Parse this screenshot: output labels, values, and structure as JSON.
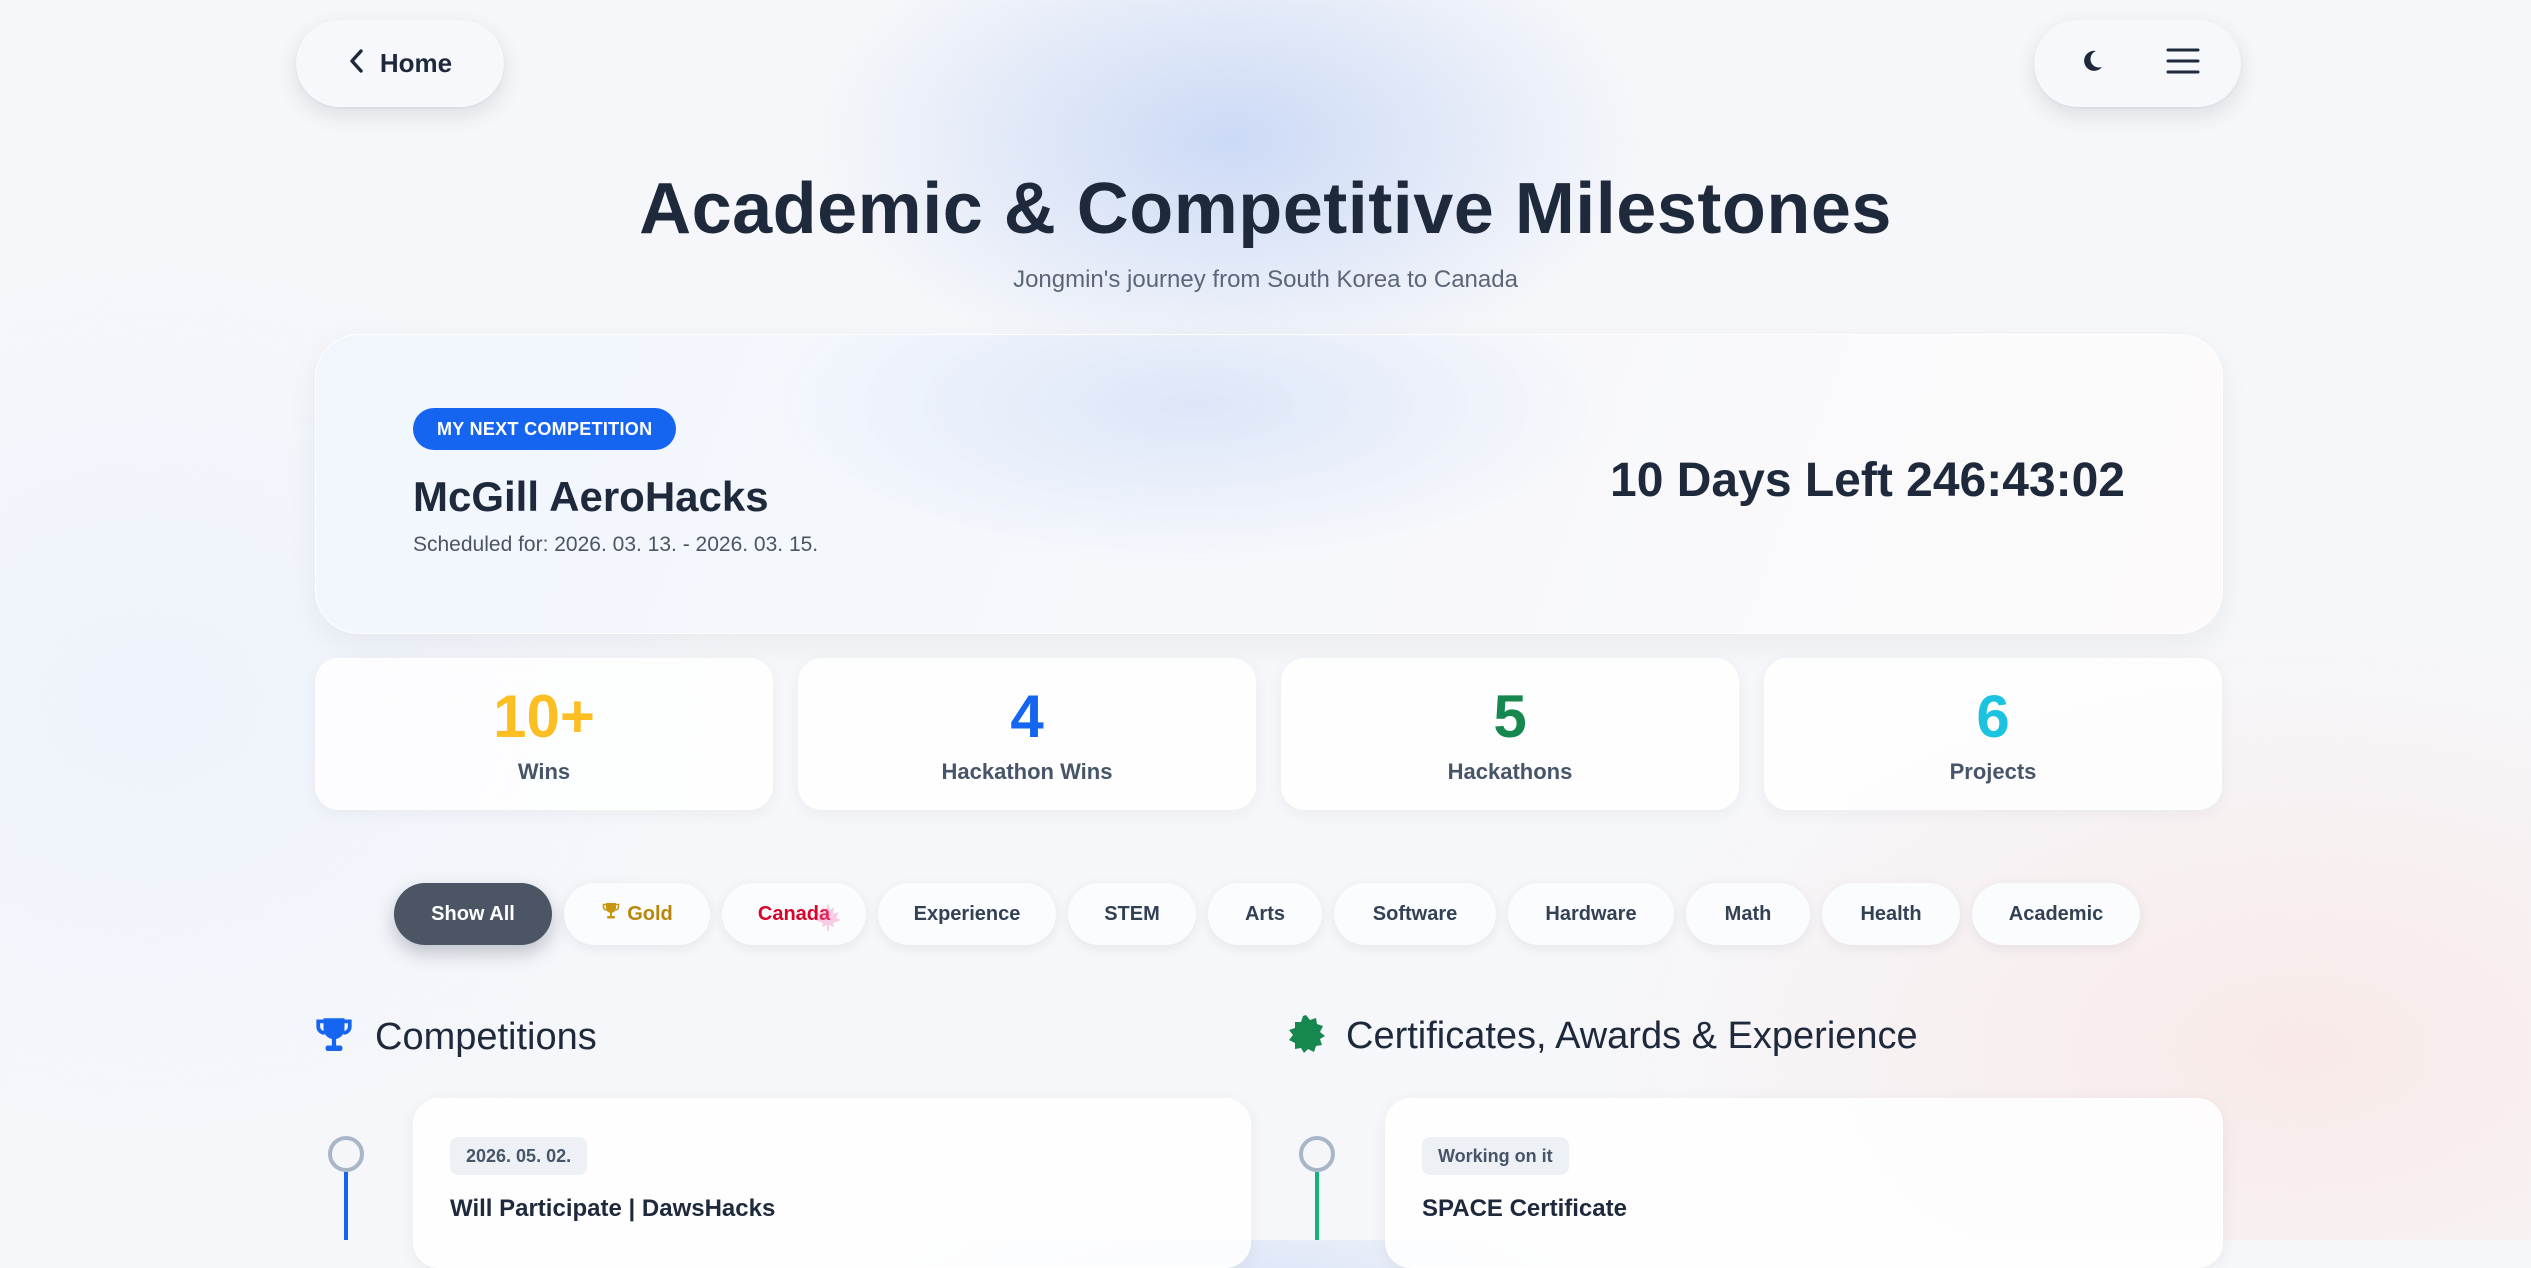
{
  "nav": {
    "home_label": "Home"
  },
  "header": {
    "title": "Academic & Competitive Milestones",
    "subtitle": "Jongmin's journey from South Korea to Canada"
  },
  "next_competition": {
    "badge": "MY NEXT COMPETITION",
    "name": "McGill AeroHacks",
    "schedule": "Scheduled for: 2026. 03. 13. - 2026. 03. 15.",
    "countdown": "10 Days Left 246:43:02"
  },
  "stats": [
    {
      "value": "10+",
      "label": "Wins",
      "color": "#fbbf24"
    },
    {
      "value": "4",
      "label": "Hackathon Wins",
      "color": "#1565f0"
    },
    {
      "value": "5",
      "label": "Hackathons",
      "color": "#16884f"
    },
    {
      "value": "6",
      "label": "Projects",
      "color": "#1cc3e0"
    }
  ],
  "filters": [
    {
      "label": "Show All",
      "active": true
    },
    {
      "label": "Gold",
      "icon": "trophy-icon"
    },
    {
      "label": "Canada",
      "icon": "maple-leaf-icon"
    },
    {
      "label": "Experience"
    },
    {
      "label": "STEM"
    },
    {
      "label": "Arts"
    },
    {
      "label": "Software"
    },
    {
      "label": "Hardware"
    },
    {
      "label": "Math"
    },
    {
      "label": "Health"
    },
    {
      "label": "Academic"
    }
  ],
  "sections": {
    "competitions": {
      "title": "Competitions",
      "icon": "trophy-icon",
      "accent": "#1565f0",
      "first_entry": {
        "tag": "2026. 05. 02.",
        "title": "Will Participate | DawsHacks"
      }
    },
    "certificates": {
      "title": "Certificates, Awards & Experience",
      "icon": "certificate-badge-icon",
      "accent": "#16884f",
      "first_entry": {
        "tag": "Working on it",
        "title": "SPACE Certificate"
      }
    }
  }
}
